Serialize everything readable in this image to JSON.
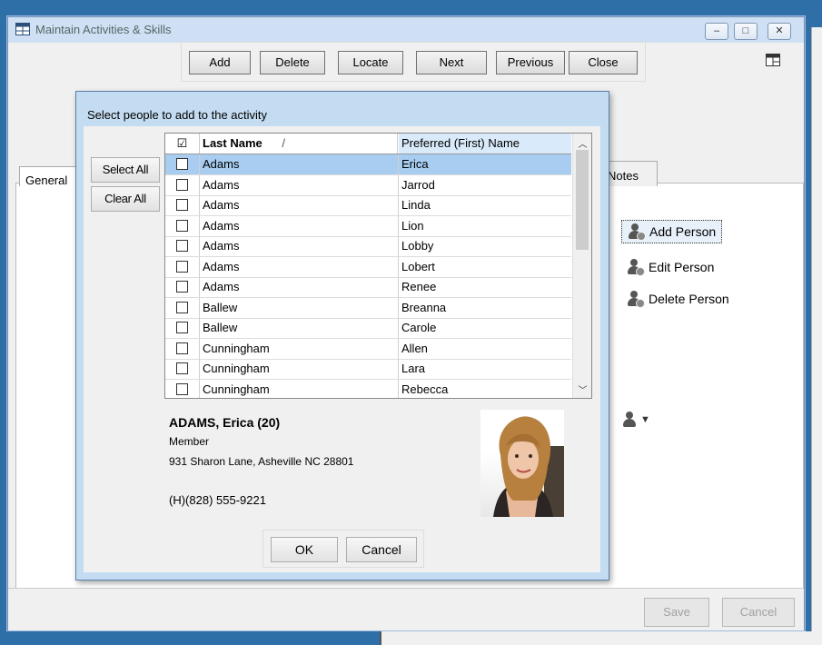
{
  "window": {
    "title": "Maintain Activities & Skills",
    "controls": [
      "–",
      "□",
      "✕"
    ]
  },
  "toolbar": {
    "add": "Add",
    "delete": "Delete",
    "locate": "Locate",
    "next": "Next",
    "previous": "Previous",
    "close": "Close"
  },
  "tabs": {
    "general": "General",
    "notes": "Notes"
  },
  "actions": {
    "add_person": "Add Person",
    "edit_person": "Edit Person",
    "delete_person": "Delete Person",
    "person_menu": "▼"
  },
  "footer": {
    "save": "Save",
    "cancel": "Cancel"
  },
  "dialog": {
    "title": "Select people to add to the activity",
    "select_all": "Select All",
    "clear_all": "Clear All",
    "columns": {
      "check": "☑",
      "last_name": "Last Name",
      "sort_indicator": "/",
      "preferred_name": "Preferred (First) Name"
    },
    "rows": [
      {
        "last": "Adams",
        "first": "Erica",
        "selected": true
      },
      {
        "last": "Adams",
        "first": "Jarrod",
        "selected": false
      },
      {
        "last": "Adams",
        "first": "Linda",
        "selected": false
      },
      {
        "last": "Adams",
        "first": "Lion",
        "selected": false
      },
      {
        "last": "Adams",
        "first": "Lobby",
        "selected": false
      },
      {
        "last": "Adams",
        "first": "Lobert",
        "selected": false
      },
      {
        "last": "Adams",
        "first": "Renee",
        "selected": false
      },
      {
        "last": "Ballew",
        "first": "Breanna",
        "selected": false
      },
      {
        "last": "Ballew",
        "first": "Carole",
        "selected": false
      },
      {
        "last": "Cunningham",
        "first": "Allen",
        "selected": false
      },
      {
        "last": "Cunningham",
        "first": "Lara",
        "selected": false
      },
      {
        "last": "Cunningham",
        "first": "Rebecca",
        "selected": false
      }
    ],
    "detail": {
      "name": "ADAMS, Erica (20)",
      "type": "Member",
      "address": "931 Sharon Lane, Asheville NC 28801",
      "phone": "(H)(828) 555-9221"
    },
    "ok": "OK",
    "cancel": "Cancel"
  },
  "colors": {
    "desktop": "#2f6fa8",
    "selection": "#a8cdf0",
    "dialog_frame": "#c4dcf1"
  }
}
